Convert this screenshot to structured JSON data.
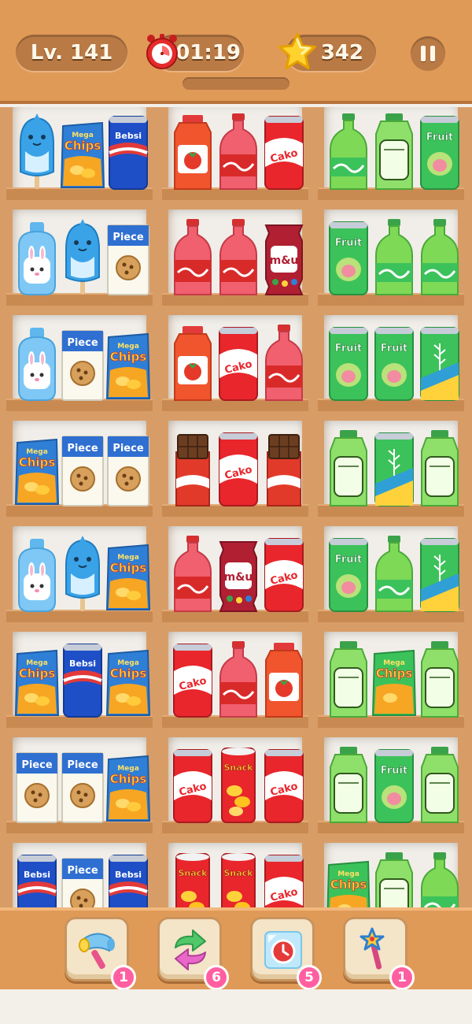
{
  "header": {
    "level": "Lv. 141",
    "timer": "01:19",
    "stars": "342",
    "colors": {
      "bar": "#e09a57",
      "pill": "#b97a45",
      "pill_text": "#fff7e8"
    }
  },
  "shelves": [
    [
      "shark",
      "chips",
      "bebsi",
      "tomato-juice",
      "soda-bottle",
      "cako-can",
      "green-bottle",
      "fruit-bottle",
      "fruit-can"
    ],
    [
      "bunny-pouch",
      "shark",
      "piece-box",
      "soda-bottle",
      "soda-bottle",
      "mu-candy",
      "fruit-can",
      "green-bottle",
      "green-bottle"
    ],
    [
      "bunny-pouch",
      "piece-box",
      "chips",
      "tomato-juice",
      "cako-can",
      "soda-bottle",
      "fruit-can",
      "fruit-can",
      "leaf-can"
    ],
    [
      "chips",
      "piece-box",
      "piece-box",
      "chocolate",
      "cako-can",
      "chocolate",
      "fruit-bottle",
      "leaf-can",
      "fruit-bottle"
    ],
    [
      "bunny-pouch",
      "shark",
      "chips",
      "soda-bottle",
      "mu-candy",
      "cako-can",
      "fruit-can",
      "green-bottle",
      "leaf-can"
    ],
    [
      "chips",
      "bebsi",
      "chips",
      "cako-can",
      "soda-bottle",
      "tomato-juice",
      "fruit-bottle",
      "green-chips",
      "fruit-bottle"
    ],
    [
      "piece-box",
      "piece-box",
      "chips",
      "cako-can",
      "snack-tube",
      "cako-can",
      "fruit-bottle",
      "fruit-can",
      "fruit-bottle"
    ],
    [
      "bebsi",
      "piece-box",
      "bebsi",
      "snack-tube",
      "snack-tube",
      "cako-can",
      "green-chips",
      "fruit-bottle",
      "green-bottle"
    ]
  ],
  "labels": {
    "chips_top": "Mega",
    "chips": "Chips",
    "bebsi": "Bebsi",
    "piece": "Piece",
    "cako": "Cako",
    "fruit": "Fruit",
    "mu": "m&u",
    "snack": "Snack"
  },
  "boosters": [
    {
      "name": "hammer",
      "count": "1",
      "icon": "hammer-icon"
    },
    {
      "name": "shuffle",
      "count": "6",
      "icon": "shuffle-icon"
    },
    {
      "name": "freeze",
      "count": "5",
      "icon": "freeze-icon"
    },
    {
      "name": "magic-wand",
      "count": "1",
      "icon": "magic-wand-icon"
    }
  ]
}
